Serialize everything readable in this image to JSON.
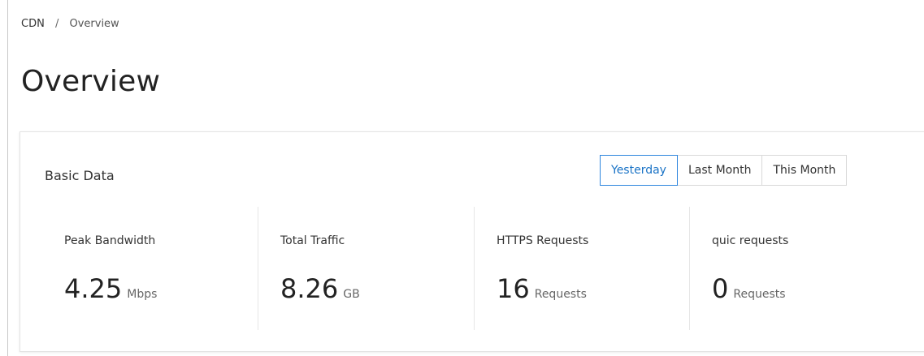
{
  "breadcrumb": {
    "root": "CDN",
    "separator": "/",
    "current": "Overview"
  },
  "page": {
    "title": "Overview"
  },
  "basic_data": {
    "title": "Basic Data",
    "range_options": [
      "Yesterday",
      "Last Month",
      "This Month"
    ],
    "selected_range": "Yesterday",
    "metrics": [
      {
        "label": "Peak Bandwidth",
        "value": "4.25",
        "unit": "Mbps"
      },
      {
        "label": "Total Traffic",
        "value": "8.26",
        "unit": "GB"
      },
      {
        "label": "HTTPS Requests",
        "value": "16",
        "unit": "Requests"
      },
      {
        "label": "quic requests",
        "value": "0",
        "unit": "Requests"
      }
    ]
  },
  "colors": {
    "accent": "#1a73c6",
    "accent_border": "#2e86de",
    "border": "#d9d9d9",
    "text": "#333333"
  }
}
